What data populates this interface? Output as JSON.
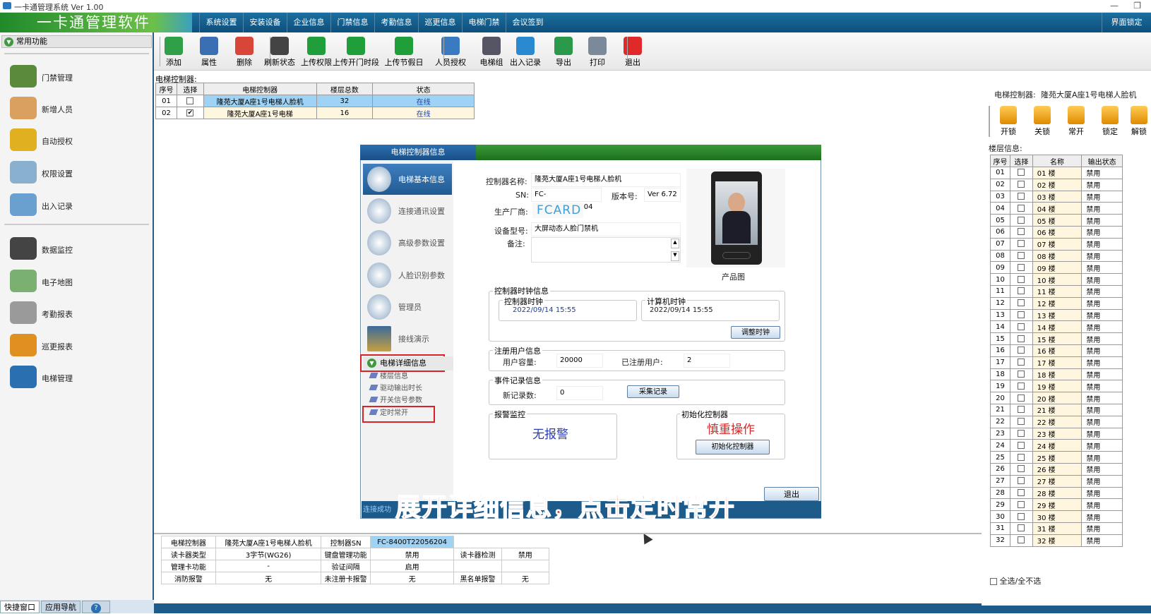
{
  "window": {
    "title": "一卡通管理系统  Ver 1.00"
  },
  "topbar": {
    "brand": "一卡通管理软件",
    "menu": [
      "系统设置",
      "安装设备",
      "企业信息",
      "门禁信息",
      "考勤信息",
      "巡更信息",
      "电梯门禁",
      "会议签到"
    ],
    "lock_label": "界面锁定"
  },
  "leftpanel": {
    "header": "常用功能",
    "items": [
      "门禁管理",
      "新增人员",
      "自动授权",
      "权限设置",
      "出入记录",
      "数据监控",
      "电子地图",
      "考勤报表",
      "巡更报表",
      "电梯管理"
    ],
    "tabs": [
      "快捷窗口",
      "应用导航"
    ]
  },
  "toolbar": {
    "buttons": [
      "添加",
      "属性",
      "删除",
      "刷新状态",
      "上传权限",
      "上传开门时段",
      "上传节假日",
      "人员授权",
      "电梯组",
      "出入记录",
      "导出",
      "打印",
      "退出"
    ]
  },
  "controllers": {
    "label": "电梯控制器:",
    "headers": [
      "序号",
      "选择",
      "电梯控制器",
      "楼层总数",
      "状态"
    ],
    "rows": [
      {
        "no": "01",
        "checked": "",
        "name": "隆苑大厦A座1号电梯人脸机",
        "floors": "32",
        "status": "在线"
      },
      {
        "no": "02",
        "checked": "✔",
        "name": "隆苑大厦A座1号电梯",
        "floors": "16",
        "status": "在线"
      }
    ]
  },
  "dialog": {
    "title": "电梯控制器信息",
    "nav": [
      "电梯基本信息",
      "连接通讯设置",
      "高级参数设置",
      "人脸识别参数",
      "管理员",
      "接线演示"
    ],
    "detail_header": "电梯详细信息",
    "sub_items": [
      "楼层信息",
      "驱动输出时长",
      "开关信号参数",
      "定时常开"
    ],
    "name_label": "控制器名称:",
    "name_value": "隆苑大厦A座1号电梯人脸机",
    "sn_label": "SN:",
    "sn_value": "FC-8400T22056204",
    "ver_label": "版本号:",
    "ver_value": "Ver 6.72",
    "maker_label": "生产厂商:",
    "maker_value": "FCARD",
    "model_label": "设备型号:",
    "model_value": "大屏动态人脸门禁机",
    "remark_label": "备注:",
    "product_caption": "产品图",
    "clock_group": "控制器时钟信息",
    "ctrl_clock_label": "控制器时钟",
    "ctrl_clock_value": "2022/09/14 15:55",
    "pc_clock_label": "计算机时钟",
    "pc_clock_value": "2022/09/14 15:55",
    "adjust_btn": "调整时钟",
    "users_group": "注册用户信息",
    "capacity_label": "用户容量:",
    "capacity_value": "20000",
    "registered_label": "已注册用户:",
    "registered_value": "2",
    "events_group": "事件记录信息",
    "new_records_label": "新记录数:",
    "new_records_value": "0",
    "collect_btn": "采集记录",
    "alarm_group": "报警监控",
    "alarm_value": "无报警",
    "init_group": "初始化控制器",
    "init_warning": "慎重操作",
    "init_btn": "初始化控制器",
    "exit_btn": "退出",
    "footer_text": "连接成功"
  },
  "caption": "展开详细信息，点击定时常开",
  "info_table": {
    "rows": [
      [
        "电梯控制器",
        "隆苑大厦A座1号电梯人脸机",
        "控制器SN",
        "FC-8400T22056204",
        "",
        ""
      ],
      [
        "读卡器类型",
        "3字节(WG26)",
        "键盘管理功能",
        "禁用",
        "读卡器检测",
        "禁用"
      ],
      [
        "管理卡功能",
        "-",
        "验证间隔",
        "启用",
        "",
        ""
      ],
      [
        "消防报警",
        "无",
        "未注册卡报警",
        "无",
        "黑名单报警",
        "无"
      ]
    ]
  },
  "right": {
    "ctrl_label": "电梯控制器:",
    "ctrl_name": "隆苑大厦A座1号电梯人脸机",
    "buttons": [
      "开锁",
      "关锁",
      "常开",
      "锁定",
      "解锁"
    ],
    "floor_label": "楼层信息:",
    "floor_headers": [
      "序号",
      "选择",
      "名称",
      "输出状态"
    ],
    "floor_status": "禁用",
    "select_all": "全选/全不选"
  },
  "colors": {
    "accent": "#1a5f92",
    "alarm": "#d42a2a",
    "highlight": "#9fd3f5"
  }
}
